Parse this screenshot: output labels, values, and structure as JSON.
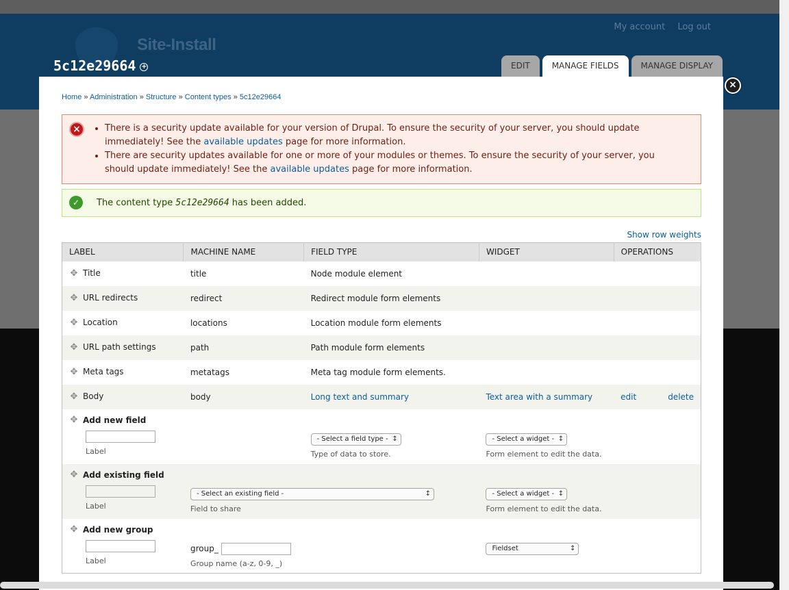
{
  "site": {
    "name": "Site-Install",
    "top_links": [
      "My account",
      "Log out"
    ]
  },
  "page": {
    "title": "5c12e29664",
    "tabs": [
      "EDIT",
      "MANAGE FIELDS",
      "MANAGE DISPLAY"
    ],
    "active_tab": "MANAGE FIELDS"
  },
  "breadcrumb": [
    "Home",
    "Administration",
    "Structure",
    "Content types",
    "5c12e29664"
  ],
  "messages": {
    "error": [
      {
        "before": "There is a security update available for your version of Drupal. To ensure the security of your server, you should update immediately! See the ",
        "link": "available updates",
        "after": " page for more information."
      },
      {
        "before": "There are security updates available for one or more of your modules or themes. To ensure the security of your server, you should update immediately! See the ",
        "link": "available updates",
        "after": " page for more information."
      }
    ],
    "status": {
      "before": "The content type ",
      "em": "5c12e29664",
      "after": " has been added."
    }
  },
  "show_row_weights": "Show row weights",
  "table": {
    "headers": [
      "LABEL",
      "MACHINE NAME",
      "FIELD TYPE",
      "WIDGET",
      "OPERATIONS"
    ],
    "rows": [
      {
        "label": "Title",
        "machine": "title",
        "type": "Node module element"
      },
      {
        "label": "URL redirects",
        "machine": "redirect",
        "type": "Redirect module form elements"
      },
      {
        "label": "Location",
        "machine": "locations",
        "type": "Location module form elements"
      },
      {
        "label": "URL path settings",
        "machine": "path",
        "type": "Path module form elements"
      },
      {
        "label": "Meta tags",
        "machine": "metatags",
        "type": "Meta tag module form elements."
      },
      {
        "label": "Body",
        "machine": "body",
        "type": "Long text and summary",
        "widget": "Text area with a summary",
        "ops": [
          "edit",
          "delete"
        ]
      }
    ],
    "add_new_field": {
      "title": "Add new field",
      "label_caption": "Label",
      "type_select": "- Select a field type -",
      "type_desc": "Type of data to store.",
      "widget_select": "- Select a widget -",
      "widget_desc": "Form element to edit the data."
    },
    "add_existing_field": {
      "title": "Add existing field",
      "label_caption": "Label",
      "field_select": "- Select an existing field -",
      "field_desc": "Field to share",
      "widget_select": "- Select a widget -",
      "widget_desc": "Form element to edit the data."
    },
    "add_new_group": {
      "title": "Add new group",
      "label_caption": "Label",
      "group_prefix": "group_",
      "group_desc": "Group name (a-z, 0-9, _)",
      "format_select": "Fieldset"
    }
  }
}
